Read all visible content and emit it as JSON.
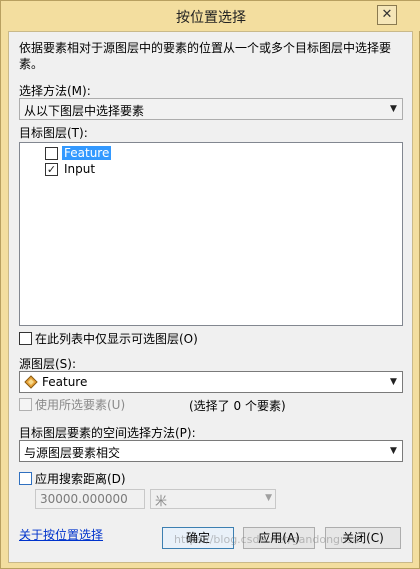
{
  "window": {
    "title": "按位置选择",
    "close_glyph": "✕"
  },
  "description": "依据要素相对于源图层中的要素的位置从一个或多个目标图层中选择要素。",
  "selection_method": {
    "label": "选择方法(M):",
    "value": "从以下图层中选择要素"
  },
  "target_layers": {
    "label": "目标图层(T):",
    "items": [
      {
        "name": "Feature",
        "checked": false,
        "highlighted": true
      },
      {
        "name": "Input",
        "checked": true,
        "highlighted": false
      }
    ],
    "only_selectable_label": "在此列表中仅显示可选图层(O)"
  },
  "source_layer": {
    "label": "源图层(S):",
    "value": "Feature",
    "icon": "feature-layer-icon",
    "use_selected_label": "使用所选要素(U)",
    "selected_count_text": "(选择了 0 个要素)"
  },
  "spatial_method": {
    "label": "目标图层要素的空间选择方法(P):",
    "value": "与源图层要素相交"
  },
  "search_distance": {
    "label": "应用搜索距离(D)",
    "value": "30000.000000",
    "unit": "米"
  },
  "footer": {
    "help_link": "关于按位置选择",
    "ok": "确定",
    "apply": "应用(A)",
    "close": "关闭(C)"
  },
  "watermark": "https://blog.csdn.net/gandongusa"
}
